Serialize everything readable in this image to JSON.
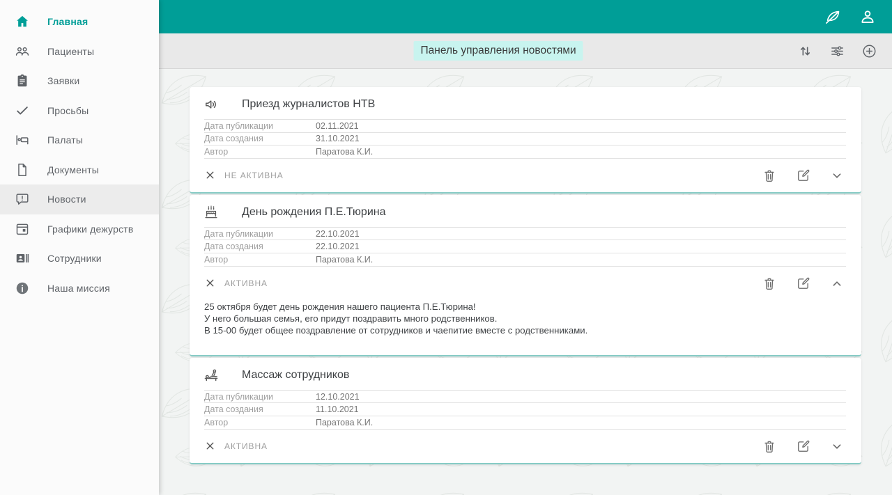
{
  "app": {
    "accent_color": "#009e97",
    "highlight_color": "#c8f4ef",
    "card_border_color": "#86cbc5"
  },
  "topbar": {
    "icons": [
      "leaf-logo-icon",
      "account-icon"
    ]
  },
  "toolbar": {
    "title": "Панель управления новостями",
    "icons": [
      "sort-icon",
      "filter-icon",
      "add-icon"
    ]
  },
  "sidebar": {
    "items": [
      {
        "label": "Главная",
        "icon": "home-icon",
        "active": true
      },
      {
        "label": "Пациенты",
        "icon": "patients-icon"
      },
      {
        "label": "Заявки",
        "icon": "clipboard-icon"
      },
      {
        "label": "Просьбы",
        "icon": "check-icon"
      },
      {
        "label": "Палаты",
        "icon": "bed-icon"
      },
      {
        "label": "Документы",
        "icon": "document-icon"
      },
      {
        "label": "Новости",
        "icon": "news-icon",
        "selected": true
      },
      {
        "label": "Графики дежурств",
        "icon": "calendar-icon"
      },
      {
        "label": "Сотрудники",
        "icon": "badge-icon"
      },
      {
        "label": "Наша миссия",
        "icon": "info-icon"
      }
    ]
  },
  "news": {
    "field_labels": {
      "published": "Дата публикации",
      "created": "Дата создания",
      "author": "Автор"
    },
    "cards": [
      {
        "icon": "megaphone-icon",
        "title": "Приезд журналистов НТВ",
        "published": "02.11.2021",
        "created": "31.10.2021",
        "author": "Паратова К.И.",
        "status": "НЕ АКТИВНА",
        "expanded": false
      },
      {
        "icon": "cake-icon",
        "title": "День рождения П.Е.Тюрина",
        "published": "22.10.2021",
        "created": "22.10.2021",
        "author": "Паратова К.И.",
        "status": "АКТИВНА",
        "expanded": true,
        "body_lines": [
          "25 октября будет день рождения нашего пациента П.Е.Тюрина!",
          "У него большая семья, его придут поздравить много родственников.",
          "В 15-00 будет общее поздравление от сотрудников и чаепитие вместе с родственниками."
        ]
      },
      {
        "icon": "massage-icon",
        "title": "Массаж сотрудников",
        "published": "12.10.2021",
        "created": "11.10.2021",
        "author": "Паратова К.И.",
        "status": "АКТИВНА",
        "expanded": false
      }
    ]
  }
}
